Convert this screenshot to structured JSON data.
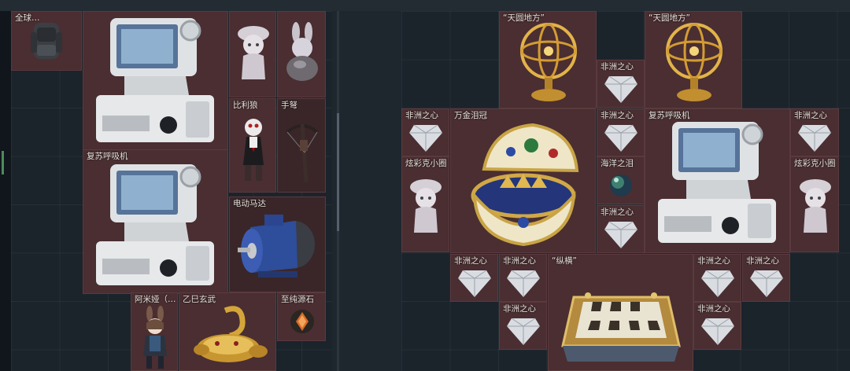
{
  "labels": {
    "left_top_item": "全球…",
    "revive_machine": "复苏呼吸机",
    "billy": "比利狼",
    "crossbow": "手弩",
    "motor": "电动马达",
    "amiya": "阿米娅（…",
    "xuanwu": "乙巳玄武",
    "pure_stone": "至纯源石",
    "tianyuan_1": "“天圆地方”",
    "tianyuan_2": "“天圆地方”",
    "heart_of_sea": "非洲之心",
    "crown": "万金泪冠",
    "revive_machine_right": "复苏呼吸机",
    "colorful_kitty": "炫彩克小圈",
    "ocean_tear": "海洋之泪",
    "chess": "“纵横”"
  },
  "icons": [
    "backpack-icon",
    "medical-ventilator-icon",
    "cat-figurine-icon",
    "bunny-egg-icon",
    "jigsaw-puppet-icon",
    "crossbow-icon",
    "electric-motor-icon",
    "anime-figure-icon",
    "golden-tortoise-icon",
    "origin-stone-icon",
    "armillary-sphere-icon",
    "diamond-icon",
    "jeweled-egg-crown-icon",
    "sea-pearl-icon",
    "chessboard-icon"
  ],
  "colors": {
    "slot_red": "#4a2e31",
    "grid": "#1b232b"
  }
}
